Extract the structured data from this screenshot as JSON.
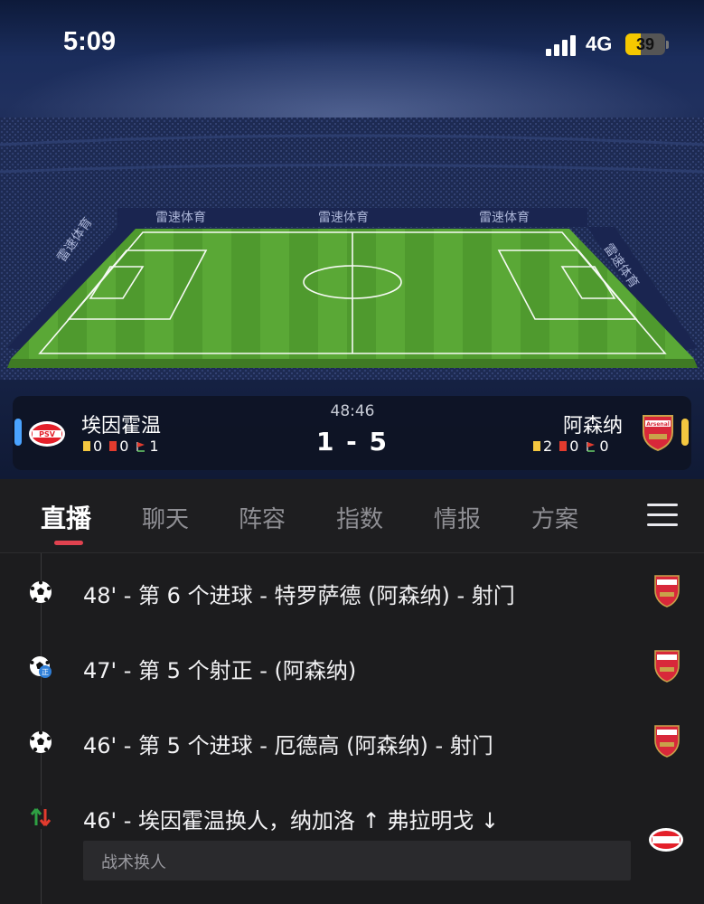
{
  "status_bar": {
    "time": "5:09",
    "network": "4G",
    "battery": "39",
    "battery_level": 0.39
  },
  "stadium": {
    "sponsor_boards": [
      "雷速体育",
      "雷速体育",
      "雷速体育",
      "雷速体育",
      "雷速体育"
    ]
  },
  "match": {
    "clock": "48:46",
    "score": "1 - 5",
    "home": {
      "name": "埃因霍温",
      "logo_text": "PSV",
      "yellow": "0",
      "red": "0",
      "corners": "1",
      "color": "#4aa3ff"
    },
    "away": {
      "name": "阿森纳",
      "logo_text": "Arsenal",
      "yellow": "2",
      "red": "0",
      "corners": "0",
      "color": "#f4c740"
    }
  },
  "tabs": [
    {
      "label": "直播",
      "active": true
    },
    {
      "label": "聊天",
      "active": false
    },
    {
      "label": "阵容",
      "active": false
    },
    {
      "label": "指数",
      "active": false
    },
    {
      "label": "情报",
      "active": false
    },
    {
      "label": "方案",
      "active": false
    }
  ],
  "events": [
    {
      "icon": "soccer-ball-icon",
      "text": "48' - 第 6 个进球 - 特罗萨德 (阿森纳) - 射门",
      "team": "Arsenal"
    },
    {
      "icon": "shot-on-target-icon",
      "text": "47' - 第 5 个射正 - (阿森纳)",
      "team": "Arsenal"
    },
    {
      "icon": "soccer-ball-icon",
      "text": "46' - 第 5 个进球 - 厄德高 (阿森纳) - 射门",
      "team": "Arsenal"
    },
    {
      "icon": "substitution-icon",
      "text": "46' - 埃因霍温换人，纳加洛 ↑ 弗拉明戈 ↓",
      "team": "PSV",
      "note": "战术换人"
    }
  ]
}
